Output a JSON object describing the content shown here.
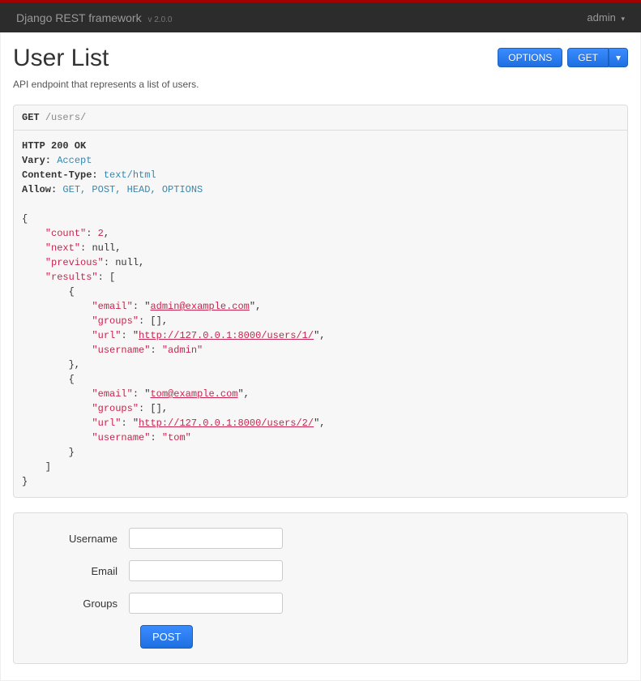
{
  "topbar": {
    "brand": "Django REST framework",
    "version": "v 2.0.0",
    "user": "admin"
  },
  "header": {
    "title": "User List",
    "options_btn": "OPTIONS",
    "get_btn": "GET"
  },
  "description": "API endpoint that represents a list of users.",
  "request": {
    "method": "GET",
    "path": "/users/"
  },
  "response": {
    "status_line": "HTTP 200 OK",
    "headers": [
      {
        "name": "Vary:",
        "value": "Accept"
      },
      {
        "name": "Content-Type:",
        "value": "text/html"
      },
      {
        "name": "Allow:",
        "value": "GET, POST, HEAD, OPTIONS"
      }
    ],
    "body": {
      "count": 2,
      "next": null,
      "previous": null,
      "results": [
        {
          "email": "admin@example.com",
          "groups": [],
          "url": "http://127.0.0.1:8000/users/1/",
          "username": "admin"
        },
        {
          "email": "tom@example.com",
          "groups": [],
          "url": "http://127.0.0.1:8000/users/2/",
          "username": "tom"
        }
      ]
    }
  },
  "form": {
    "fields": [
      {
        "label": "Username",
        "name": "username"
      },
      {
        "label": "Email",
        "name": "email"
      },
      {
        "label": "Groups",
        "name": "groups"
      }
    ],
    "submit": "POST"
  }
}
